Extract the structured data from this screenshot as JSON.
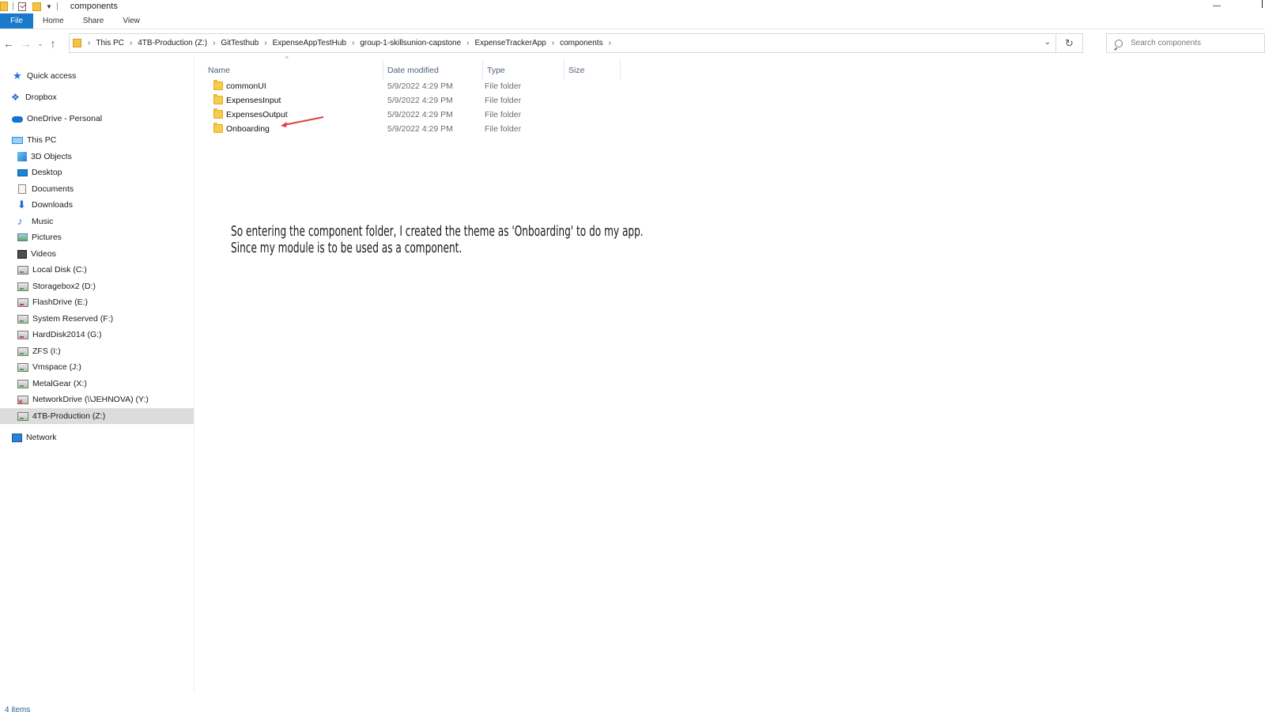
{
  "window": {
    "title": "components"
  },
  "ribbon": {
    "tabs": [
      "File",
      "Home",
      "Share",
      "View"
    ]
  },
  "address": {
    "crumbs": [
      "This PC",
      "4TB-Production (Z:)",
      "GitTesthub",
      "ExpenseAppTestHub",
      "group-1-skillsunion-capstone",
      "ExpenseTrackerApp",
      "components"
    ]
  },
  "search": {
    "placeholder": "Search components"
  },
  "sidebar": {
    "items": [
      {
        "label": "Quick access",
        "icon": "star-icon"
      },
      {
        "label": "Dropbox",
        "icon": "dropbox-icon"
      },
      {
        "label": "OneDrive - Personal",
        "icon": "cloud-icon"
      },
      {
        "label": "This PC",
        "icon": "computer-icon"
      },
      {
        "label": "3D Objects",
        "icon": "cube-icon"
      },
      {
        "label": "Desktop",
        "icon": "desktop-icon"
      },
      {
        "label": "Documents",
        "icon": "document-icon"
      },
      {
        "label": "Downloads",
        "icon": "download-icon"
      },
      {
        "label": "Music",
        "icon": "music-icon"
      },
      {
        "label": "Pictures",
        "icon": "pictures-icon"
      },
      {
        "label": "Videos",
        "icon": "video-icon"
      },
      {
        "label": "Local Disk (C:)",
        "icon": "drive-icon"
      },
      {
        "label": "Storagebox2 (D:)",
        "icon": "drive-icon"
      },
      {
        "label": "FlashDrive (E:)",
        "icon": "drive-icon"
      },
      {
        "label": "System Reserved (F:)",
        "icon": "drive-icon"
      },
      {
        "label": "HardDisk2014 (G:)",
        "icon": "drive-icon"
      },
      {
        "label": "ZFS (I:)",
        "icon": "drive-icon"
      },
      {
        "label": "Vmspace (J:)",
        "icon": "drive-icon"
      },
      {
        "label": "MetalGear (X:)",
        "icon": "drive-icon"
      },
      {
        "label": "NetworkDrive (\\\\JEHNOVA) (Y:)",
        "icon": "network-drive-icon"
      },
      {
        "label": "4TB-Production (Z:)",
        "icon": "drive-icon",
        "selected": true
      },
      {
        "label": "Network",
        "icon": "network-icon"
      }
    ]
  },
  "columns": {
    "name": "Name",
    "date": "Date modified",
    "type": "Type",
    "size": "Size"
  },
  "files": [
    {
      "name": "commonUI",
      "date": "5/9/2022 4:29 PM",
      "type": "File folder"
    },
    {
      "name": "ExpensesInput",
      "date": "5/9/2022 4:29 PM",
      "type": "File folder"
    },
    {
      "name": "ExpensesOutput",
      "date": "5/9/2022 4:29 PM",
      "type": "File folder"
    },
    {
      "name": "Onboarding",
      "date": "5/9/2022 4:29 PM",
      "type": "File folder"
    }
  ],
  "annotation": {
    "line1": "So entering the component folder, I created the theme as 'Onboarding' to do my app.",
    "line2": "Since my module is to be used as a component."
  },
  "status": {
    "items": "4 items"
  },
  "colors": {
    "accent": "#1979ca",
    "selection": "#dcdcdc",
    "arrow": "#e03c3c"
  }
}
